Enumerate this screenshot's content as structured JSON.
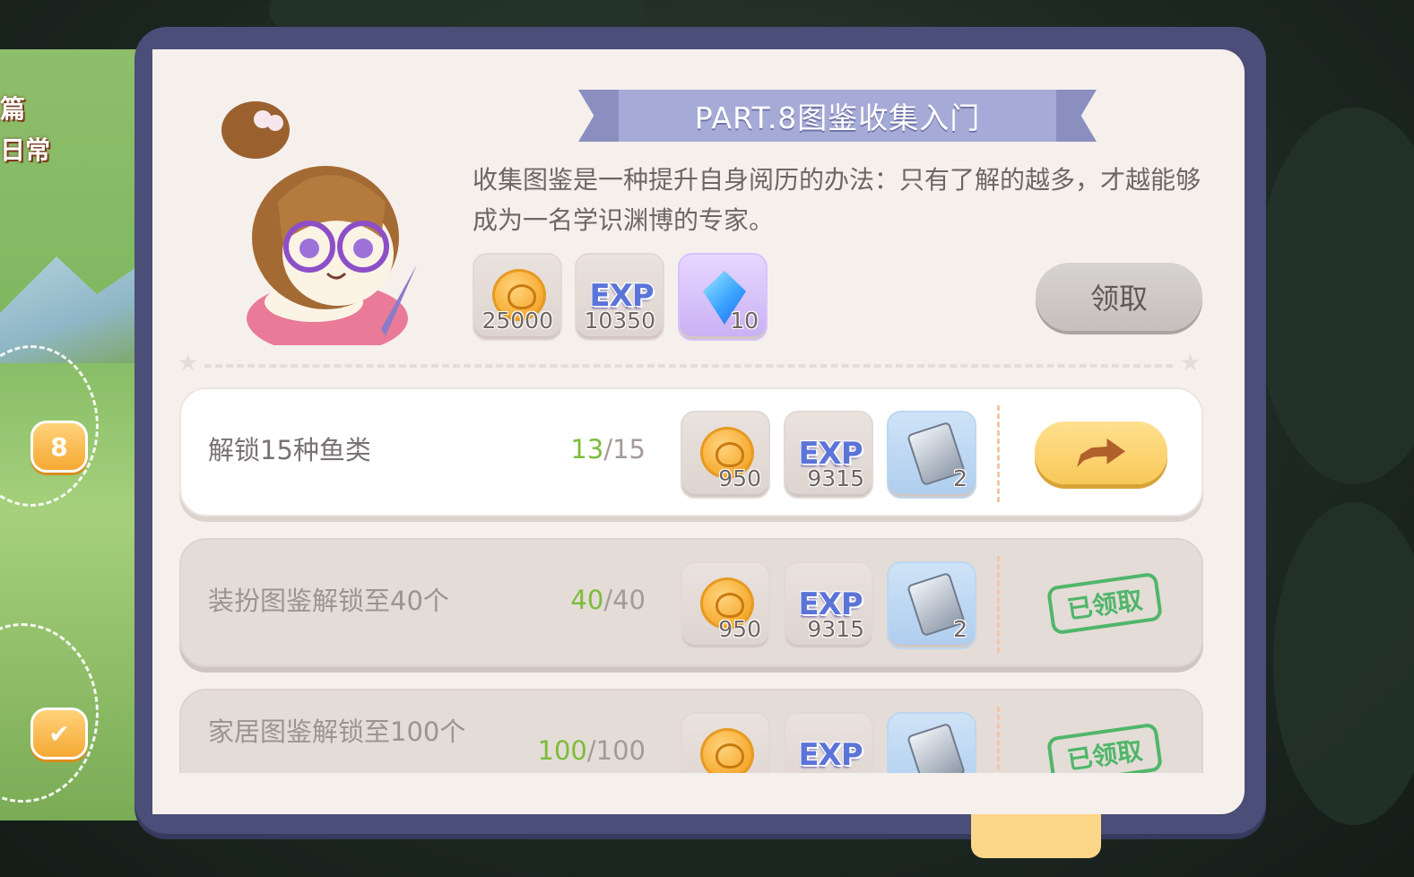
{
  "sidebar": {
    "title_line1": "篇",
    "title_line2": "日常",
    "level_badge": "8"
  },
  "dialog": {
    "title": "PART.8图鉴收集入门",
    "description": "收集图鉴是一种提升自身阅历的办法：只有了解的越多，才越能够成为一名学识渊博的专家。",
    "rewards": [
      {
        "icon": "coin-icon",
        "amount": "25000"
      },
      {
        "icon": "exp-icon",
        "label": "EXP",
        "amount": "10350"
      },
      {
        "icon": "diamond-icon",
        "amount": "10"
      }
    ],
    "claim_label": "领取"
  },
  "tasks": [
    {
      "name": "解锁15种鱼类",
      "current": "13",
      "sep": "/",
      "total": "15",
      "rewards": [
        {
          "icon": "coin-icon",
          "amount": "950"
        },
        {
          "icon": "exp-icon",
          "label": "EXP",
          "amount": "9315"
        },
        {
          "icon": "ticket-icon",
          "amount": "2"
        }
      ],
      "status": "go"
    },
    {
      "name": "装扮图鉴解锁至40个",
      "current": "40",
      "sep": "/",
      "total": "40",
      "rewards": [
        {
          "icon": "coin-icon",
          "amount": "950"
        },
        {
          "icon": "exp-icon",
          "label": "EXP",
          "amount": "9315"
        },
        {
          "icon": "ticket-icon",
          "amount": "2"
        }
      ],
      "status": "claimed",
      "status_label": "已领取"
    },
    {
      "name": "家居图鉴解锁至100个",
      "current": "100",
      "sep": "/",
      "total": "100",
      "rewards": [
        {
          "icon": "coin-icon",
          "amount": ""
        },
        {
          "icon": "exp-icon",
          "label": "EXP",
          "amount": ""
        },
        {
          "icon": "ticket-icon",
          "amount": ""
        }
      ],
      "status": "claimed",
      "status_label": "已领取"
    }
  ],
  "colors": {
    "frame": "#4a4e78",
    "panel": "#f6f0ec",
    "ribbon": "#a6aad6",
    "progress_current": "#7cbc3b",
    "go_button": "#f8c958",
    "claimed_stamp": "#4fb66a"
  }
}
